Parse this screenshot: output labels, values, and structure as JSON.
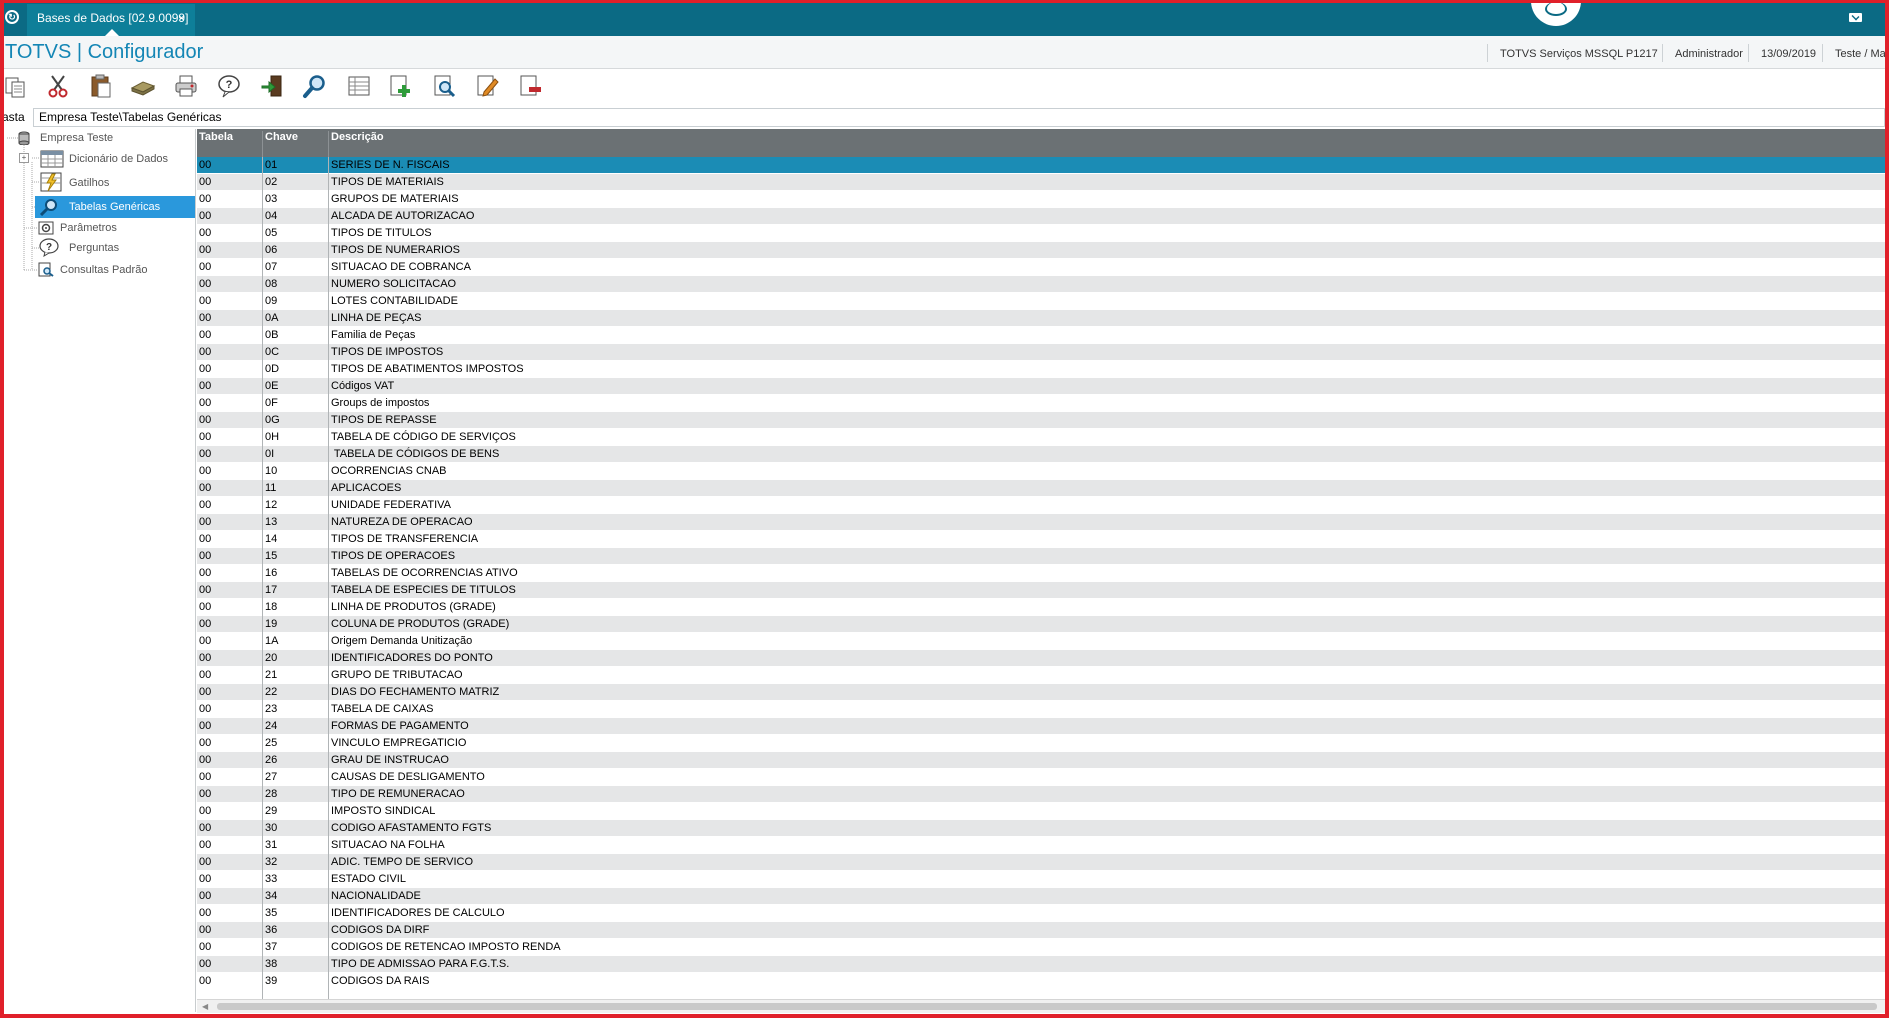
{
  "topbar": {
    "tab_label": "Bases de Dados [02.9.0099]",
    "tab_close": "×"
  },
  "header": {
    "app_title": "TOTVS | Configurador",
    "environment": "TOTVS Serviços MSSQL P1217",
    "user": "Administrador",
    "date": "13/09/2019",
    "company": "Teste / Ma"
  },
  "path": {
    "label": "asta",
    "value": "Empresa Teste\\Tabelas Genéricas"
  },
  "tree": {
    "root": "Empresa Teste",
    "items": [
      {
        "label": "Dicionário de Dados"
      },
      {
        "label": "Gatilhos"
      },
      {
        "label": "Tabelas Genéricas",
        "selected": true
      },
      {
        "label": "Parâmetros"
      },
      {
        "label": "Perguntas"
      },
      {
        "label": "Consultas Padrão"
      }
    ]
  },
  "grid": {
    "columns": [
      "Tabela",
      "Chave",
      "Descrição"
    ],
    "selected_index": 0,
    "rows": [
      [
        "00",
        "01",
        "SERIES DE N. FISCAIS"
      ],
      [
        "00",
        "02",
        "TIPOS DE MATERIAIS"
      ],
      [
        "00",
        "03",
        "GRUPOS DE MATERIAIS"
      ],
      [
        "00",
        "04",
        "ALCADA DE AUTORIZACAO"
      ],
      [
        "00",
        "05",
        "TIPOS DE TITULOS"
      ],
      [
        "00",
        "06",
        "TIPOS DE NUMERARIOS"
      ],
      [
        "00",
        "07",
        "SITUACAO DE COBRANCA"
      ],
      [
        "00",
        "08",
        "NUMERO SOLICITACAO"
      ],
      [
        "00",
        "09",
        "LOTES CONTABILIDADE"
      ],
      [
        "00",
        "0A",
        "LINHA DE PEÇAS"
      ],
      [
        "00",
        "0B",
        "Familia de Peças"
      ],
      [
        "00",
        "0C",
        "TIPOS DE IMPOSTOS"
      ],
      [
        "00",
        "0D",
        "TIPOS DE ABATIMENTOS IMPOSTOS"
      ],
      [
        "00",
        "0E",
        "Códigos VAT"
      ],
      [
        "00",
        "0F",
        "Groups de impostos"
      ],
      [
        "00",
        "0G",
        "TIPOS DE REPASSE"
      ],
      [
        "00",
        "0H",
        "TABELA DE CÓDIGO DE SERVIÇOS"
      ],
      [
        "00",
        "0I",
        " TABELA DE CÓDIGOS DE BENS"
      ],
      [
        "00",
        "10",
        "OCORRENCIAS CNAB"
      ],
      [
        "00",
        "11",
        "APLICACOES"
      ],
      [
        "00",
        "12",
        "UNIDADE FEDERATIVA"
      ],
      [
        "00",
        "13",
        "NATUREZA DE OPERACAO"
      ],
      [
        "00",
        "14",
        "TIPOS DE TRANSFERENCIA"
      ],
      [
        "00",
        "15",
        "TIPOS DE OPERACOES"
      ],
      [
        "00",
        "16",
        "TABELAS DE OCORRENCIAS ATIVO"
      ],
      [
        "00",
        "17",
        "TABELA DE ESPECIES DE TITULOS"
      ],
      [
        "00",
        "18",
        "LINHA DE PRODUTOS (GRADE)"
      ],
      [
        "00",
        "19",
        "COLUNA DE PRODUTOS (GRADE)"
      ],
      [
        "00",
        "1A",
        "Origem Demanda Unitização"
      ],
      [
        "00",
        "20",
        "IDENTIFICADORES DO PONTO"
      ],
      [
        "00",
        "21",
        "GRUPO DE TRIBUTACAO"
      ],
      [
        "00",
        "22",
        "DIAS DO FECHAMENTO MATRIZ"
      ],
      [
        "00",
        "23",
        "TABELA DE CAIXAS"
      ],
      [
        "00",
        "24",
        "FORMAS DE PAGAMENTO"
      ],
      [
        "00",
        "25",
        "VINCULO EMPREGATICIO"
      ],
      [
        "00",
        "26",
        "GRAU DE INSTRUCAO"
      ],
      [
        "00",
        "27",
        "CAUSAS DE DESLIGAMENTO"
      ],
      [
        "00",
        "28",
        "TIPO DE REMUNERACAO"
      ],
      [
        "00",
        "29",
        "IMPOSTO SINDICAL"
      ],
      [
        "00",
        "30",
        "CODIGO AFASTAMENTO FGTS"
      ],
      [
        "00",
        "31",
        "SITUACAO NA FOLHA"
      ],
      [
        "00",
        "32",
        "ADIC. TEMPO DE SERVICO"
      ],
      [
        "00",
        "33",
        "ESTADO CIVIL"
      ],
      [
        "00",
        "34",
        "NACIONALIDADE"
      ],
      [
        "00",
        "35",
        "IDENTIFICADORES DE CALCULO"
      ],
      [
        "00",
        "36",
        "CODIGOS DA DIRF"
      ],
      [
        "00",
        "37",
        "CODIGOS DE RETENCAO IMPOSTO RENDA"
      ],
      [
        "00",
        "38",
        "TIPO DE ADMISSAO PARA F.G.T.S."
      ],
      [
        "00",
        "39",
        "CODIGOS DA RAIS"
      ]
    ]
  },
  "icons": {
    "toolbar": [
      "copy-icon",
      "cut-icon",
      "paste-icon",
      "book-icon",
      "print-icon",
      "help-icon",
      "exit-icon",
      "search-icon",
      "grid-icon",
      "add-document-icon",
      "preview-icon",
      "edit-icon",
      "delete-document-icon"
    ]
  },
  "colors": {
    "topbar": "#0b6a84",
    "title": "#1486b5",
    "header": "#6b7174",
    "selected_row": "#1b8cb5",
    "tree_selected": "#2a98dc",
    "frame": "#e0202a"
  }
}
